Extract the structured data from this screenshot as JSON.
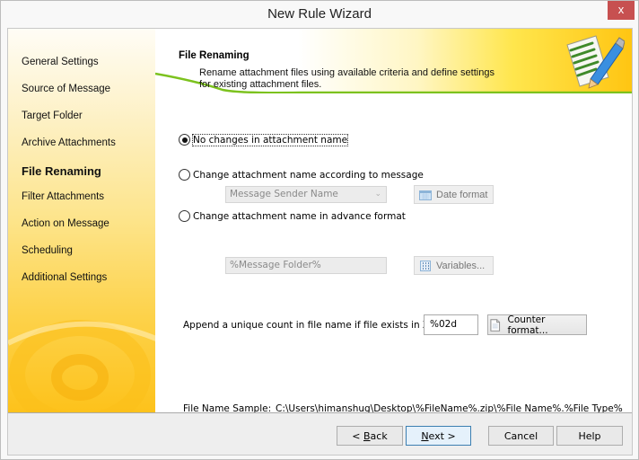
{
  "window": {
    "title": "New Rule Wizard",
    "close_label": "x"
  },
  "sidebar": {
    "items": [
      {
        "label": "General Settings",
        "active": false
      },
      {
        "label": "Source of Message",
        "active": false
      },
      {
        "label": "Target Folder",
        "active": false
      },
      {
        "label": "Archive Attachments",
        "active": false
      },
      {
        "label": "File Renaming",
        "active": true
      },
      {
        "label": "Filter Attachments",
        "active": false
      },
      {
        "label": "Action on Message",
        "active": false
      },
      {
        "label": "Scheduling",
        "active": false
      },
      {
        "label": "Additional Settings",
        "active": false
      }
    ]
  },
  "header": {
    "title": "File Renaming",
    "description": "Rename attachment files using available criteria and define settings for existing attachment files.",
    "icon": "document-pencil-icon"
  },
  "options": {
    "no_change": {
      "label": "No changes in attachment name",
      "checked": true
    },
    "by_message": {
      "label": "Change attachment name according to message",
      "checked": false,
      "combo_value": "Message Sender Name",
      "date_button": "Date format",
      "date_icon": "calendar-icon"
    },
    "advanced": {
      "label": "Change attachment name in advance format",
      "checked": false,
      "format_value": "%Message Folder%",
      "variables_button": "Variables...",
      "variables_icon": "variables-icon"
    }
  },
  "counter": {
    "label": "Append a unique count in file name if file exists in ZIP:",
    "value": "%02d",
    "button": "Counter format...",
    "button_icon": "document-icon"
  },
  "sample": {
    "label": "File Name Sample:",
    "value": "C:\\Users\\himanshug\\Desktop\\%FileName%.zip\\%File Name%.%File Type%"
  },
  "footer": {
    "back": {
      "prefix": "< ",
      "mnemonic": "B",
      "rest": "ack"
    },
    "next": {
      "mnemonic": "N",
      "rest": "ext >"
    },
    "cancel": "Cancel",
    "help": "Help"
  },
  "colors": {
    "close_button": "#c75050",
    "banner_accent": "#ffc512",
    "curve_green": "#7cc21e",
    "default_button_border": "#3c7fb1"
  }
}
